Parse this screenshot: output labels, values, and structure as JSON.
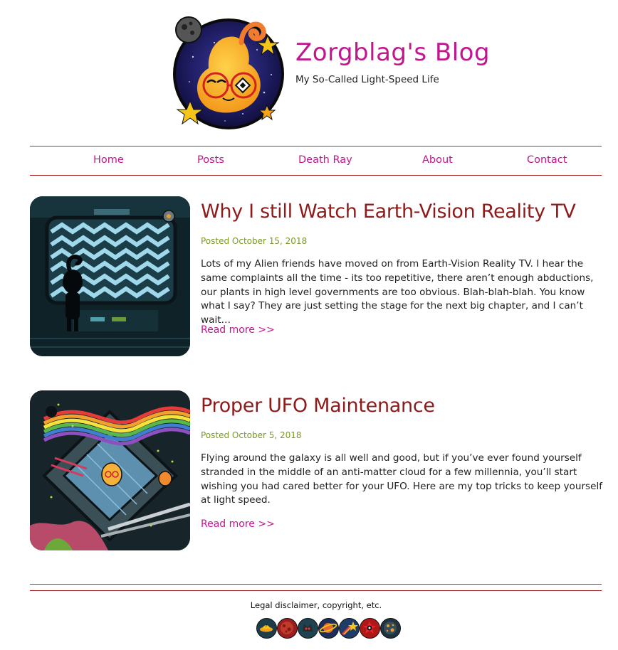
{
  "site": {
    "title": "Zorgblag's Blog",
    "tagline": "My So-Called Light-Speed Life"
  },
  "nav": {
    "items": [
      {
        "label": "Home"
      },
      {
        "label": "Posts"
      },
      {
        "label": "Death Ray"
      },
      {
        "label": "About"
      },
      {
        "label": "Contact"
      }
    ]
  },
  "posts": [
    {
      "title": "Why I still Watch Earth-Vision Reality TV",
      "date": "Posted October 15, 2018",
      "excerpt": "Lots of my Alien friends have moved on from Earth-Vision Reality TV. I hear the same complaints all the time - its too repetitive, there aren’t enough abductions, our plants in high level governments are too obvious. Blah-blah-blah. You know what I say? They are just setting the stage for the next big chapter, and I can’t wait…",
      "read_more": "Read more >>"
    },
    {
      "title": "Proper UFO Maintenance",
      "date": "Posted October 5, 2018",
      "excerpt": "Flying around the galaxy is all well and good, but if you’ve ever found yourself stranded in the middle of an anti-matter cloud for a few millennia, you’ll start wishing you had cared better for your UFO. Here are my top tricks to keep yourself at light speed.",
      "read_more": "Read more >>"
    }
  ],
  "footer": {
    "legal": "Legal disclaimer, copyright, etc.",
    "icons": [
      "ufo-icon",
      "mars-planet-icon",
      "alien-cat-icon",
      "ringed-planet-icon",
      "comet-icon",
      "red-alien-icon",
      "asteroid-icon"
    ]
  },
  "colors": {
    "brand": "#c2168f",
    "post_title": "#8e1b1b",
    "date": "#7a9a22"
  }
}
